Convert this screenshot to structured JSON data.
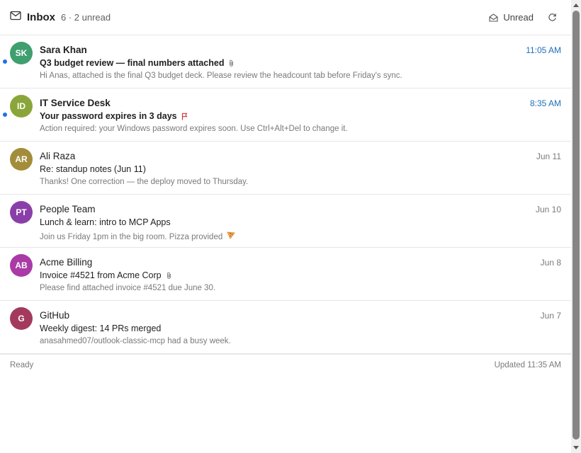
{
  "header": {
    "title": "Inbox",
    "count": "6 · 2 unread",
    "unread_label": "Unread",
    "icons": {
      "mail": "mail-icon",
      "unread": "envelope-open-icon",
      "refresh": "refresh-icon"
    }
  },
  "messages": [
    {
      "initials": "SK",
      "color": "#3f9f6e",
      "sender": "Sara Khan",
      "subject": "Q3 budget review — final numbers attached",
      "preview": "Hi Anas, attached is the final Q3 budget deck. Please review the headcount tab before Friday's sync.",
      "time": "11:05 AM",
      "unread": true,
      "attachment": true
    },
    {
      "initials": "ID",
      "color": "#8aa63a",
      "sender": "IT Service Desk",
      "subject": "Your password expires in 3 days",
      "preview": "Action required: your Windows password expires soon. Use Ctrl+Alt+Del to change it.",
      "time": "8:35 AM",
      "unread": true,
      "flagged": true
    },
    {
      "initials": "AR",
      "color": "#a38d3a",
      "sender": "Ali Raza",
      "subject": "Re: standup notes (Jun 11)",
      "preview": "Thanks! One correction — the deploy moved to Thursday.",
      "time": "Jun 11",
      "unread": false
    },
    {
      "initials": "PT",
      "color": "#8a3fa8",
      "sender": "People Team",
      "subject": "Lunch & learn: intro to MCP Apps",
      "preview": "Join us Friday 1pm in the big room. Pizza provided",
      "time": "Jun 10",
      "unread": false,
      "emoji": "pizza"
    },
    {
      "initials": "AB",
      "color": "#a93aa6",
      "sender": "Acme Billing",
      "subject": "Invoice #4521 from Acme Corp",
      "preview": "Please find attached invoice #4521 due June 30.",
      "time": "Jun 8",
      "unread": false,
      "attachment": true
    },
    {
      "initials": "G",
      "color": "#a33a5e",
      "sender": "GitHub",
      "subject": "Weekly digest: 14 PRs merged",
      "preview": "anasahmed07/outlook-classic-mcp had a busy week.",
      "time": "Jun 7",
      "unread": false
    }
  ],
  "footer": {
    "status": "Ready",
    "updated": "Updated 11:35 AM"
  },
  "colors": {
    "accent": "#1f6feb",
    "unread_time": "#1f6fb8",
    "flag": "#d13438"
  }
}
